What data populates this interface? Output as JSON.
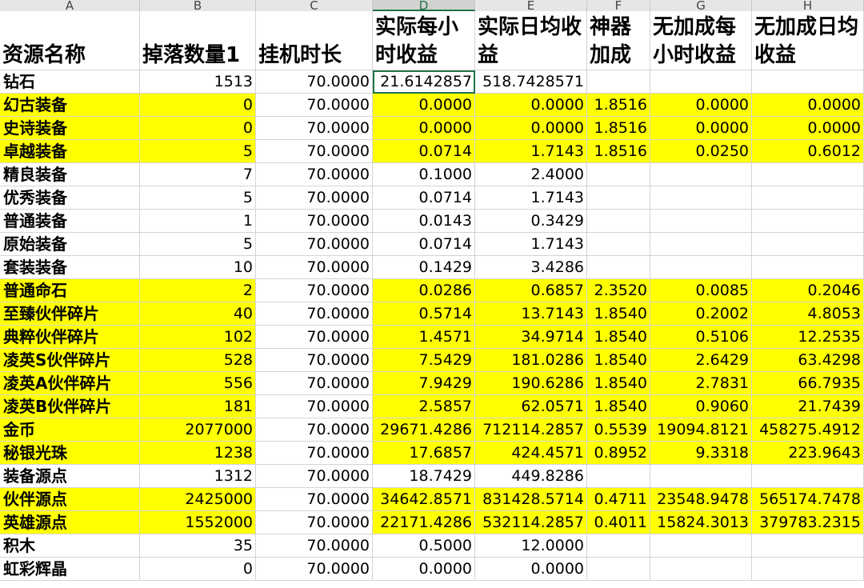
{
  "columns": [
    "A",
    "B",
    "C",
    "D",
    "E",
    "F",
    "G",
    "H"
  ],
  "selected_column": "D",
  "headers": [
    "资源名称",
    "掉落数量1",
    "挂机时长",
    "实际每小时收益",
    "实际日均收益",
    "神器加成",
    "无加成每小时收益",
    "无加成日均收益"
  ],
  "rows": [
    {
      "name": "钻石",
      "drop": "1513",
      "hours": "70.0000",
      "hourly": "21.6142857",
      "daily": "518.7428571",
      "bonus": "",
      "nb_hourly": "",
      "nb_daily": "",
      "yellow": false
    },
    {
      "name": "幻古装备",
      "drop": "0",
      "hours": "70.0000",
      "hourly": "0.0000",
      "daily": "0.0000",
      "bonus": "1.8516",
      "nb_hourly": "0.0000",
      "nb_daily": "0.0000",
      "yellow": true
    },
    {
      "name": "史诗装备",
      "drop": "0",
      "hours": "70.0000",
      "hourly": "0.0000",
      "daily": "0.0000",
      "bonus": "1.8516",
      "nb_hourly": "0.0000",
      "nb_daily": "0.0000",
      "yellow": true
    },
    {
      "name": "卓越装备",
      "drop": "5",
      "hours": "70.0000",
      "hourly": "0.0714",
      "daily": "1.7143",
      "bonus": "1.8516",
      "nb_hourly": "0.0250",
      "nb_daily": "0.6012",
      "yellow": true
    },
    {
      "name": "精良装备",
      "drop": "7",
      "hours": "70.0000",
      "hourly": "0.1000",
      "daily": "2.4000",
      "bonus": "",
      "nb_hourly": "",
      "nb_daily": "",
      "yellow": false
    },
    {
      "name": "优秀装备",
      "drop": "5",
      "hours": "70.0000",
      "hourly": "0.0714",
      "daily": "1.7143",
      "bonus": "",
      "nb_hourly": "",
      "nb_daily": "",
      "yellow": false
    },
    {
      "name": "普通装备",
      "drop": "1",
      "hours": "70.0000",
      "hourly": "0.0143",
      "daily": "0.3429",
      "bonus": "",
      "nb_hourly": "",
      "nb_daily": "",
      "yellow": false
    },
    {
      "name": "原始装备",
      "drop": "5",
      "hours": "70.0000",
      "hourly": "0.0714",
      "daily": "1.7143",
      "bonus": "",
      "nb_hourly": "",
      "nb_daily": "",
      "yellow": false
    },
    {
      "name": "套装装备",
      "drop": "10",
      "hours": "70.0000",
      "hourly": "0.1429",
      "daily": "3.4286",
      "bonus": "",
      "nb_hourly": "",
      "nb_daily": "",
      "yellow": false
    },
    {
      "name": "普通命石",
      "drop": "2",
      "hours": "70.0000",
      "hourly": "0.0286",
      "daily": "0.6857",
      "bonus": "2.3520",
      "nb_hourly": "0.0085",
      "nb_daily": "0.2046",
      "yellow": true
    },
    {
      "name": "至臻伙伴碎片",
      "drop": "40",
      "hours": "70.0000",
      "hourly": "0.5714",
      "daily": "13.7143",
      "bonus": "1.8540",
      "nb_hourly": "0.2002",
      "nb_daily": "4.8053",
      "yellow": true
    },
    {
      "name": "典粹伙伴碎片",
      "drop": "102",
      "hours": "70.0000",
      "hourly": "1.4571",
      "daily": "34.9714",
      "bonus": "1.8540",
      "nb_hourly": "0.5106",
      "nb_daily": "12.2535",
      "yellow": true
    },
    {
      "name": "凌英S伙伴碎片",
      "drop": "528",
      "hours": "70.0000",
      "hourly": "7.5429",
      "daily": "181.0286",
      "bonus": "1.8540",
      "nb_hourly": "2.6429",
      "nb_daily": "63.4298",
      "yellow": true
    },
    {
      "name": "凌英A伙伴碎片",
      "drop": "556",
      "hours": "70.0000",
      "hourly": "7.9429",
      "daily": "190.6286",
      "bonus": "1.8540",
      "nb_hourly": "2.7831",
      "nb_daily": "66.7935",
      "yellow": true
    },
    {
      "name": "凌英B伙伴碎片",
      "drop": "181",
      "hours": "70.0000",
      "hourly": "2.5857",
      "daily": "62.0571",
      "bonus": "1.8540",
      "nb_hourly": "0.9060",
      "nb_daily": "21.7439",
      "yellow": true
    },
    {
      "name": "金币",
      "drop": "2077000",
      "hours": "70.0000",
      "hourly": "29671.4286",
      "daily": "712114.2857",
      "bonus": "0.5539",
      "nb_hourly": "19094.8121",
      "nb_daily": "458275.4912",
      "yellow": true
    },
    {
      "name": "秘银光珠",
      "drop": "1238",
      "hours": "70.0000",
      "hourly": "17.6857",
      "daily": "424.4571",
      "bonus": "0.8952",
      "nb_hourly": "9.3318",
      "nb_daily": "223.9643",
      "yellow": true
    },
    {
      "name": "装备源点",
      "drop": "1312",
      "hours": "70.0000",
      "hourly": "18.7429",
      "daily": "449.8286",
      "bonus": "",
      "nb_hourly": "",
      "nb_daily": "",
      "yellow": false
    },
    {
      "name": "伙伴源点",
      "drop": "2425000",
      "hours": "70.0000",
      "hourly": "34642.8571",
      "daily": "831428.5714",
      "bonus": "0.4711",
      "nb_hourly": "23548.9478",
      "nb_daily": "565174.7478",
      "yellow": true
    },
    {
      "name": "英雄源点",
      "drop": "1552000",
      "hours": "70.0000",
      "hourly": "22171.4286",
      "daily": "532114.2857",
      "bonus": "0.4011",
      "nb_hourly": "15824.3013",
      "nb_daily": "379783.2315",
      "yellow": true
    },
    {
      "name": "积木",
      "drop": "35",
      "hours": "70.0000",
      "hourly": "0.5000",
      "daily": "12.0000",
      "bonus": "",
      "nb_hourly": "",
      "nb_daily": "",
      "yellow": false
    },
    {
      "name": "虹彩辉晶",
      "drop": "0",
      "hours": "70.0000",
      "hourly": "0.0000",
      "daily": "0.0000",
      "bonus": "",
      "nb_hourly": "",
      "nb_daily": "",
      "yellow": false
    }
  ]
}
